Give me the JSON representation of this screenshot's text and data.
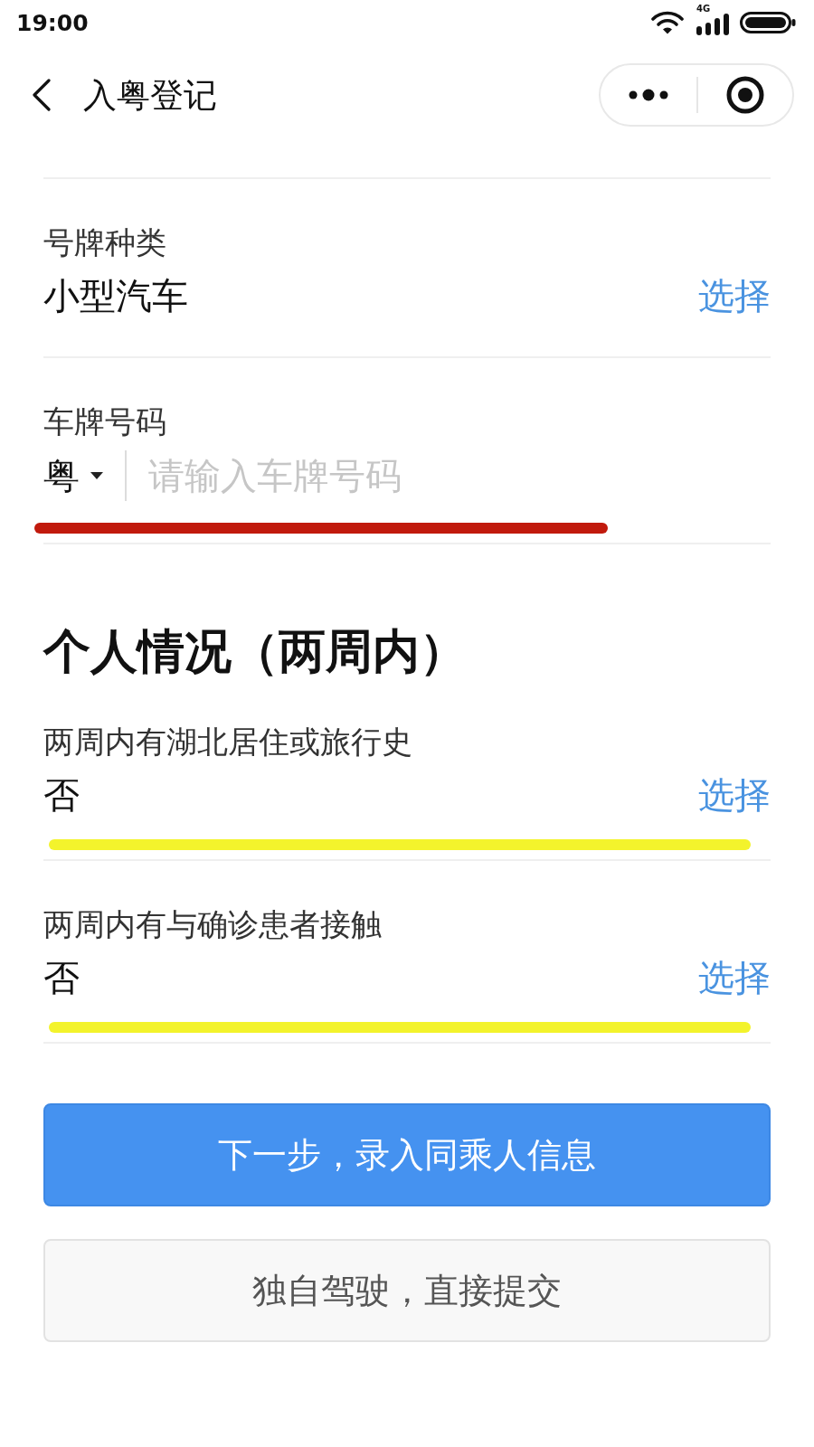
{
  "status_bar": {
    "time": "19:00",
    "network_label": "4G"
  },
  "nav_bar": {
    "title": "入粤登记"
  },
  "sections": [
    {
      "fields": [
        {
          "kind": "select",
          "label": "号牌种类",
          "value": "小型汽车",
          "action": "选择"
        },
        {
          "kind": "plate",
          "label": "车牌号码",
          "prefix": "粤",
          "placeholder": "请输入车牌号码",
          "highlight": {
            "color": "#c11a0d"
          }
        }
      ]
    },
    {
      "heading": "个人情况（两周内）",
      "fields": [
        {
          "kind": "select",
          "label": "两周内有湖北居住或旅行史",
          "value": "否",
          "action": "选择",
          "highlight": {
            "color": "#f3f32c"
          }
        },
        {
          "kind": "select",
          "label": "两周内有与确诊患者接触",
          "value": "否",
          "action": "选择",
          "highlight": {
            "color": "#f3f32c"
          }
        }
      ]
    }
  ],
  "buttons": [
    {
      "kind": "primary",
      "label": "下一步，录入同乘人信息"
    },
    {
      "kind": "secondary",
      "label": "独自驾驶，直接提交"
    }
  ]
}
